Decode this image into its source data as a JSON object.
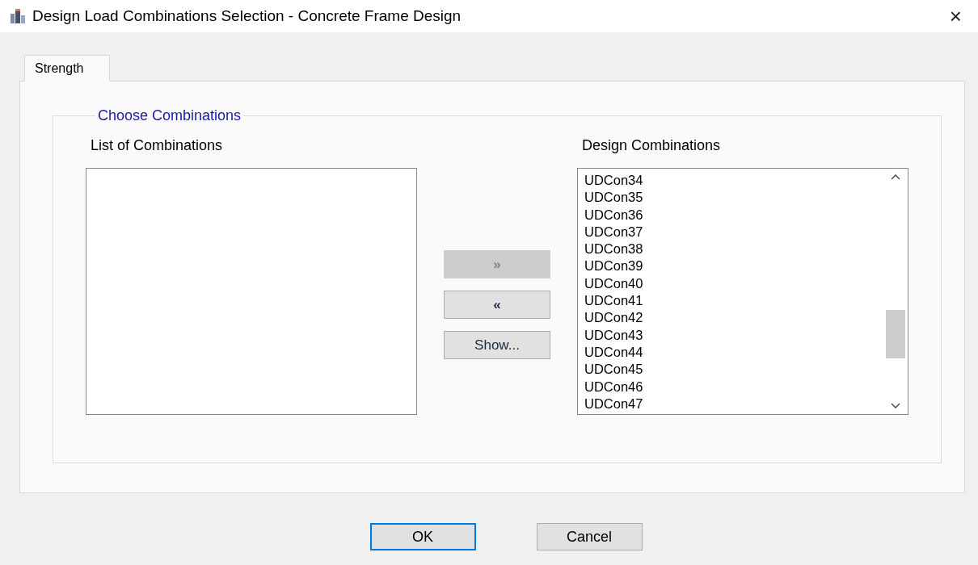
{
  "window": {
    "title": "Design Load Combinations Selection - Concrete Frame Design",
    "close": "×"
  },
  "tabs": [
    {
      "label": "Strength",
      "selected": true
    }
  ],
  "group": {
    "legend": "Choose Combinations",
    "list_of_combinations": {
      "label": "List of Combinations"
    },
    "transfer_buttons": [
      {
        "label": "»",
        "disabled": true
      },
      {
        "label": "«",
        "disabled": false
      },
      {
        "label": "Show...",
        "disabled": false
      }
    ],
    "design_combinations": {
      "label": "Design Combinations",
      "items": [
        "UDCon34",
        "UDCon35",
        "UDCon36",
        "UDCon37",
        "UDCon38",
        "UDCon39",
        "UDCon40",
        "UDCon41",
        "UDCon42",
        "UDCon43",
        "UDCon44",
        "UDCon45",
        "UDCon46",
        "UDCon47"
      ]
    }
  },
  "buttons": [
    {
      "label": "OK",
      "focused": true
    },
    {
      "label": "Cancel",
      "focused": false
    }
  ]
}
